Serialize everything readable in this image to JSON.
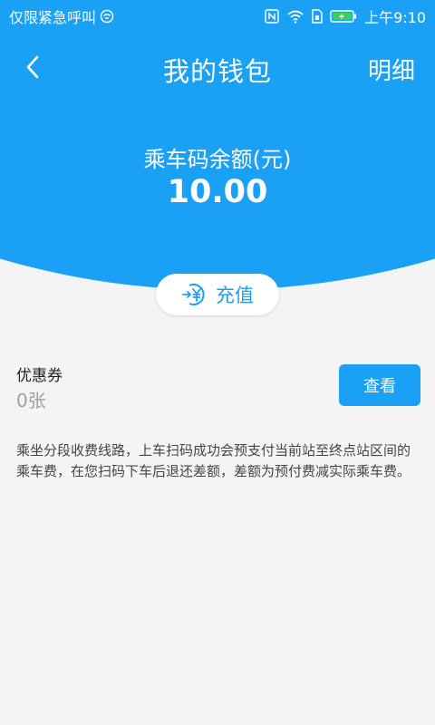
{
  "status_bar": {
    "emergency_text": "仅限紧急呼叫",
    "time": "上午9:10"
  },
  "nav": {
    "title": "我的钱包",
    "detail_label": "明细"
  },
  "balance": {
    "label": "乘车码余额(元)",
    "value": "10.00"
  },
  "recharge": {
    "label": "充值"
  },
  "coupon": {
    "title": "优惠券",
    "count": "0张",
    "view_label": "查看"
  },
  "notice": {
    "text": "乘坐分段收费线路，上车扫码成功会预支付当前站至终点站区间的乘车费，在您扫码下车后退还差额，差额为预付费减实际乘车费。"
  },
  "colors": {
    "accent": "#1aa0f4",
    "background": "#f4f4f4"
  },
  "icons": [
    "emergency-call-icon",
    "nfc-icon",
    "wifi-icon",
    "sim-icon",
    "battery-charging-icon",
    "back-arrow-icon",
    "recharge-yen-icon"
  ]
}
